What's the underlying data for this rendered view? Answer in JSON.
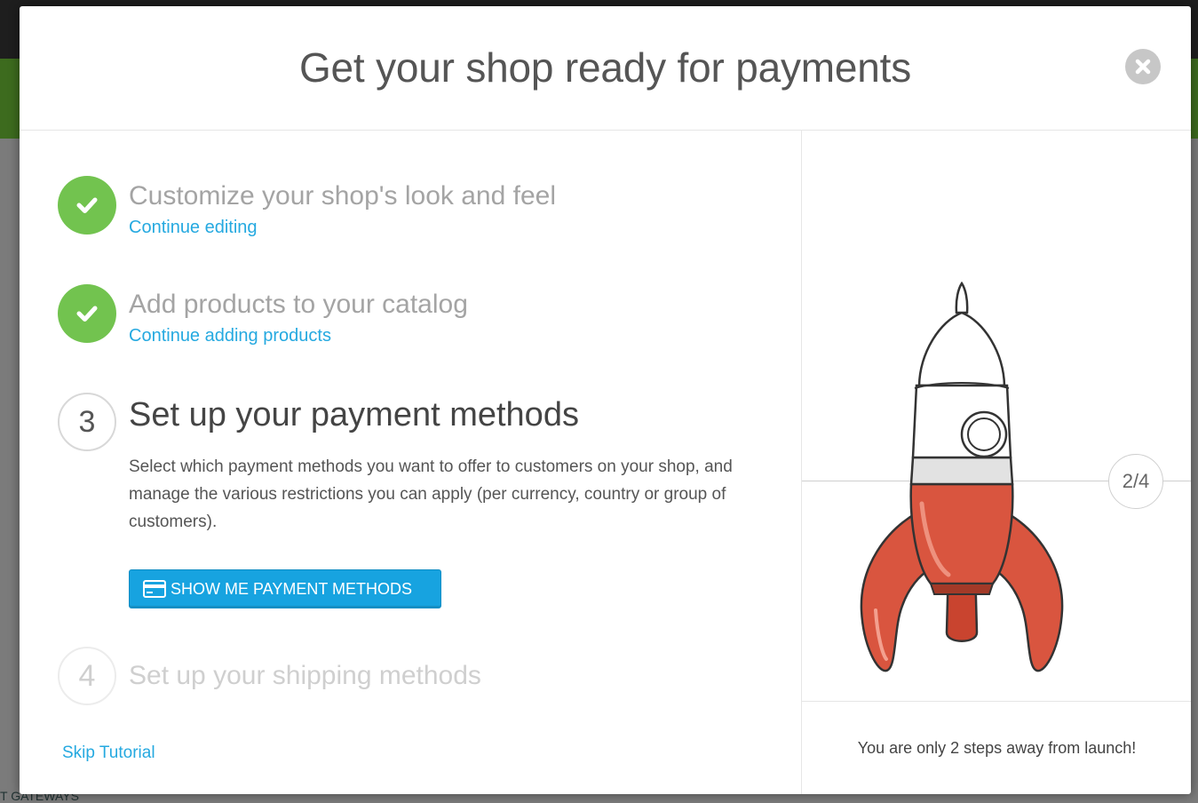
{
  "modal": {
    "title": "Get your shop ready for payments",
    "close_icon": "close-icon"
  },
  "steps": [
    {
      "number": "1",
      "status": "done",
      "title": "Customize your shop's look and feel",
      "link": "Continue editing"
    },
    {
      "number": "2",
      "status": "done",
      "title": "Add products to your catalog",
      "link": "Continue adding products"
    },
    {
      "number": "3",
      "status": "current",
      "title": "Set up your payment methods",
      "description": "Select which payment methods you want to offer to customers on your shop, and manage the various restrictions you can apply (per currency, country or group of customers).",
      "button_label": "SHOW ME PAYMENT METHODS",
      "button_icon": "credit-card-icon"
    },
    {
      "number": "4",
      "status": "pending",
      "title": "Set up your shipping methods"
    }
  ],
  "skip_label": "Skip Tutorial",
  "progress": {
    "label": "2/4",
    "current": 2,
    "total": 4
  },
  "launch_message": "You are only 2 steps away from launch!",
  "background": {
    "partial_text": "T GATEWAYS"
  },
  "colors": {
    "accent": "#25a9e0",
    "button": "#17a3e0",
    "done": "#72c34f",
    "rocket_body": "#d9553f"
  }
}
